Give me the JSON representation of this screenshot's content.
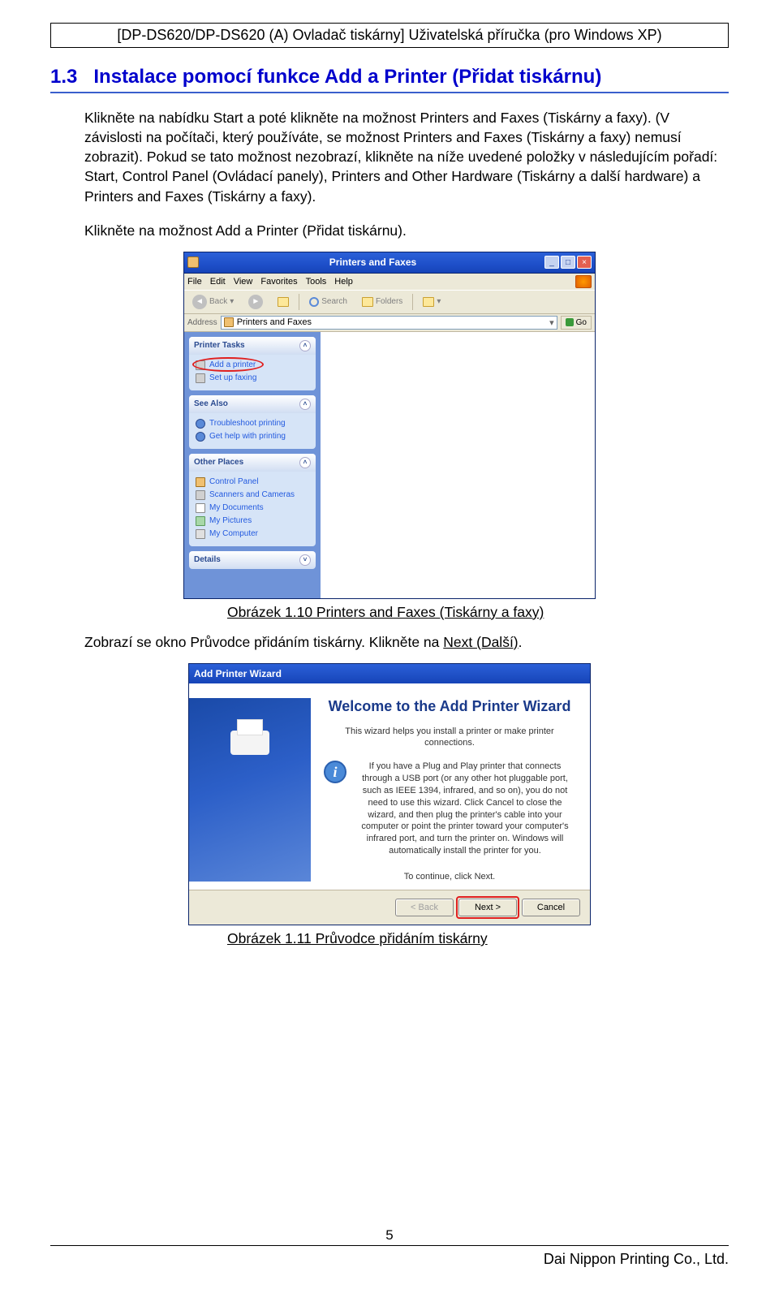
{
  "header": "[DP-DS620/DP-DS620 (A) Ovladač tiskárny] Uživatelská příručka (pro Windows XP)",
  "section": {
    "num": "1.3",
    "title": "Instalace pomocí funkce Add a Printer (Přidat tiskárnu)"
  },
  "para1": "Klikněte na nabídku Start a poté klikněte na možnost Printers and Faxes (Tiskárny a faxy). (V závislosti na počítači, který používáte, se možnost Printers and Faxes (Tiskárny a faxy) nemusí zobrazit). Pokud se tato možnost nezobrazí, klikněte na níže uvedené položky v následujícím pořadí: Start, Control Panel (Ovládací panely), Printers and Other Hardware (Tiskárny a další hardware) a Printers and Faxes (Tiskárny a faxy).",
  "para2": "Klikněte na možnost Add a Printer (Přidat tiskárnu).",
  "fig1": {
    "caption": "Obrázek 1.10 Printers and Faxes (Tiskárny a faxy)",
    "title": "Printers and Faxes",
    "menu": {
      "file": "File",
      "edit": "Edit",
      "view": "View",
      "favorites": "Favorites",
      "tools": "Tools",
      "help": "Help"
    },
    "toolbar": {
      "back": "Back",
      "search": "Search",
      "folders": "Folders"
    },
    "address": {
      "label": "Address",
      "value": "Printers and Faxes",
      "go": "Go"
    },
    "panels": {
      "tasks": {
        "title": "Printer Tasks",
        "add": "Add a printer",
        "setup": "Set up faxing"
      },
      "see": {
        "title": "See Also",
        "trouble": "Troubleshoot printing",
        "help": "Get help with printing"
      },
      "other": {
        "title": "Other Places",
        "cp": "Control Panel",
        "sc": "Scanners and Cameras",
        "md": "My Documents",
        "mp": "My Pictures",
        "mc": "My Computer"
      },
      "details": {
        "title": "Details"
      }
    }
  },
  "para3a": "Zobrazí se okno Průvodce přidáním tiskárny. Klikněte na ",
  "para3b": "Next (Další)",
  "para3c": ".",
  "fig2": {
    "caption": "Obrázek 1.11 Průvodce přidáním tiskárny",
    "title": "Add Printer Wizard",
    "heading": "Welcome to the Add Printer Wizard",
    "intro": "This wizard helps you install a printer or make printer connections.",
    "info": "If you have a Plug and Play printer that connects through a USB port (or any other hot pluggable port, such as IEEE 1394, infrared, and so on), you do not need to use this wizard. Click Cancel to close the wizard, and then plug the printer's cable into your computer or point the printer toward your computer's infrared port, and turn the printer on. Windows will automatically install the printer for you.",
    "cont": "To continue, click Next.",
    "back": "< Back",
    "next": "Next >",
    "cancel": "Cancel"
  },
  "footer": {
    "page": "5",
    "company": "Dai Nippon Printing Co., Ltd."
  }
}
